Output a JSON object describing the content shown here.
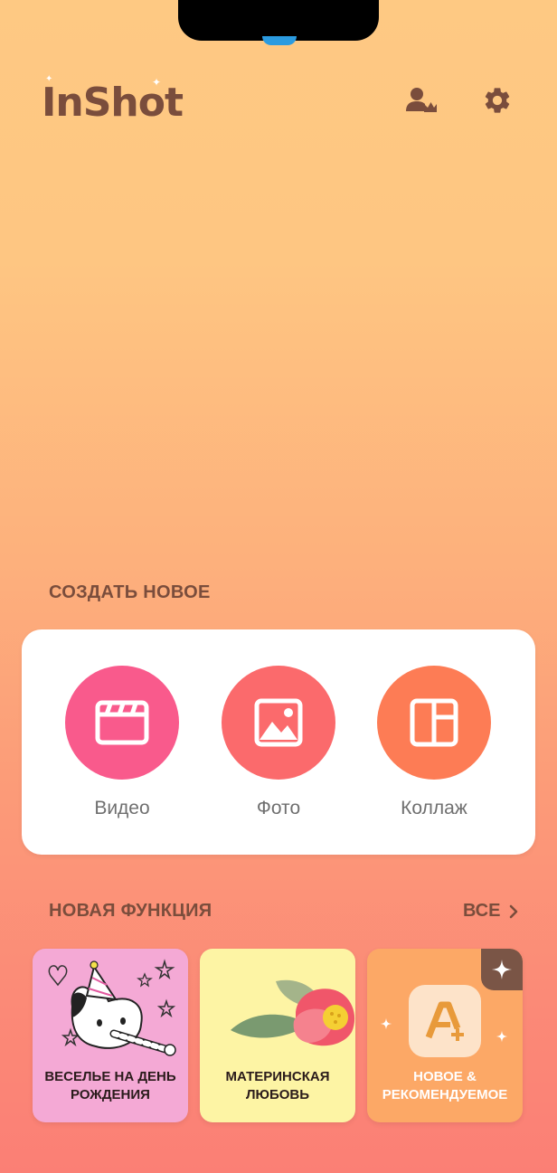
{
  "app": {
    "logo_text": "InShot"
  },
  "header": {
    "pro_icon": "user-crown-icon",
    "settings_icon": "gear-icon"
  },
  "create_section": {
    "title": "СОЗДАТЬ НОВОЕ",
    "buttons": [
      {
        "label": "Видео",
        "icon": "clapperboard-icon",
        "color": "#f95a8c"
      },
      {
        "label": "Фото",
        "icon": "image-icon",
        "color": "#fb6a6c"
      },
      {
        "label": "Коллаж",
        "icon": "collage-icon",
        "color": "#fd7c55"
      }
    ]
  },
  "features_section": {
    "title": "НОВАЯ ФУНКЦИЯ",
    "see_all_label": "ВСЕ",
    "cards": [
      {
        "label_line1": "ВЕСЕЛЬЕ НА ДЕНЬ",
        "label_line2": "РОЖДЕНИЯ",
        "background": "#f4a9d5",
        "text_color": "#2a1b1b"
      },
      {
        "label_line1": "МАТЕРИНСКАЯ",
        "label_line2": "ЛЮБОВЬ",
        "background": "#fdf4a4",
        "text_color": "#2a1b1b"
      },
      {
        "label_line1": "НОВОЕ &",
        "label_line2": "РЕКОМЕНДУЕМОЕ",
        "background": "#fca866",
        "text_color": "#ffffff"
      }
    ]
  },
  "colors": {
    "accent_text": "#7a4d3c",
    "label_gray": "#6f6f6f"
  }
}
